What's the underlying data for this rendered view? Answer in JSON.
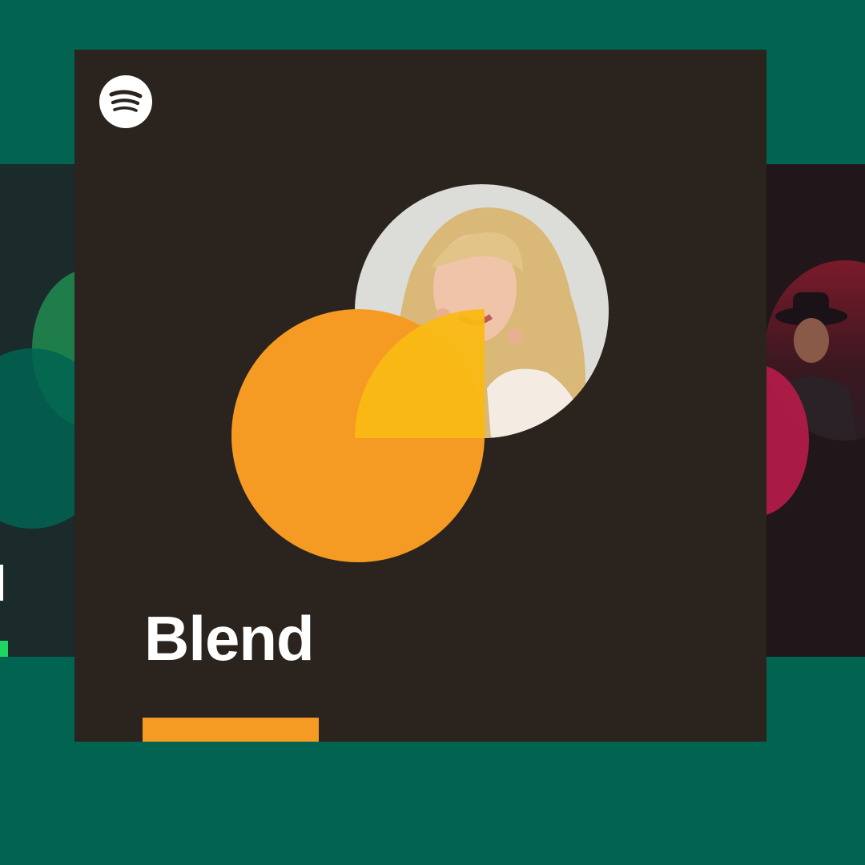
{
  "title": "Blend",
  "colors": {
    "page_bg": "#006450",
    "main_card": "#2b231d",
    "left_card": "#1b2b2b",
    "right_card": "#21161a",
    "orange": "#f59b23",
    "overlap_yellow": "#fab914",
    "left_green": "#1e7d4a",
    "left_teal": "#006452",
    "right_red": "#b81c4a",
    "white": "#ffffff"
  },
  "icons": {
    "logo": "spotify-icon",
    "main_portrait": "artist-portrait-image",
    "right_portrait": "artist-portrait-image"
  }
}
